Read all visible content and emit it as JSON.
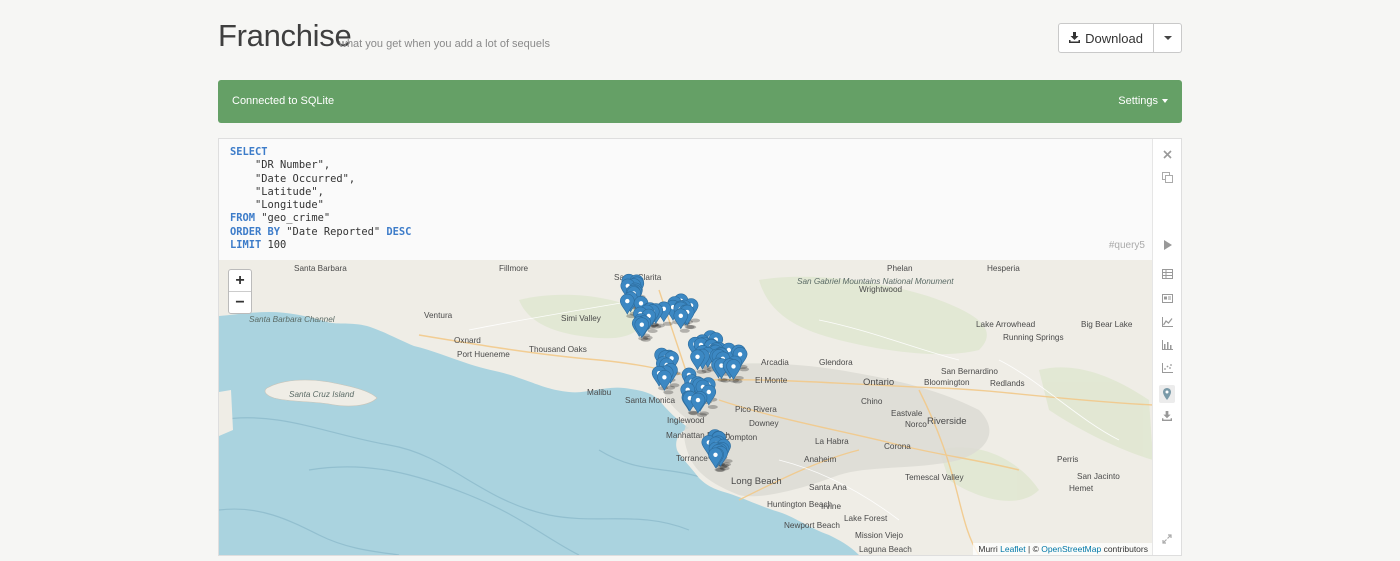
{
  "app": {
    "title": "Franchise",
    "tagline": "what you get when you add a lot of sequels"
  },
  "toolbar": {
    "download_label": "Download"
  },
  "status": {
    "connection_text": "Connected to SQLite",
    "settings_label": "Settings"
  },
  "query": {
    "code_lines": [
      [
        {
          "t": "SELECT",
          "kw": true
        }
      ],
      [
        {
          "t": "    \"DR Number\","
        }
      ],
      [
        {
          "t": "    \"Date Occurred\","
        }
      ],
      [
        {
          "t": "    \"Latitude\","
        }
      ],
      [
        {
          "t": "    \"Longitude\""
        }
      ],
      [
        {
          "t": "FROM",
          "kw": true
        },
        {
          "t": " \"geo_crime\""
        }
      ],
      [
        {
          "t": "ORDER BY",
          "kw": true
        },
        {
          "t": " \"Date Reported\" "
        },
        {
          "t": "DESC",
          "kw": true
        }
      ],
      [
        {
          "t": "LIMIT",
          "kw": true
        },
        {
          "t": " 100"
        }
      ]
    ],
    "tag": "#query5"
  },
  "side_icons": [
    "close-icon",
    "copy-icon",
    "run-icon",
    "table-view-icon",
    "card-view-icon",
    "line-chart-icon",
    "bar-chart-icon",
    "scatter-chart-icon",
    "map-view-icon",
    "download-icon",
    "expand-icon"
  ],
  "map": {
    "zoom_in": "+",
    "zoom_out": "−",
    "attribution": {
      "leaflet": "Leaflet",
      "sep": " | © ",
      "osm": "OpenStreetMap",
      "suffix": " contributors",
      "cut": "Murri"
    },
    "labels": [
      "Santa Barbara",
      "Fillmore",
      "Santa Clarita",
      "Phelan",
      "Hesperia",
      "Ventura",
      "Oxnard",
      "Simi Valley",
      "San Gabriel Mountains National Monument",
      "Wrightwood",
      "Lake Arrowhead",
      "Big Bear Lake",
      "Santa Barbara Channel",
      "Port Hueneme",
      "Thousand Oaks",
      "Arcadia",
      "Glendora",
      "Running Springs",
      "San Bernardino",
      "El Monte",
      "Ontario",
      "Bloomington",
      "Redlands",
      "Santa Cruz Island",
      "Malibu",
      "Santa Monica",
      "Pico Rivera",
      "Chino",
      "Eastvale",
      "Riverside",
      "Inglewood",
      "Downey",
      "La Habra",
      "Norco",
      "Manhattan Beach",
      "Compton",
      "Corona",
      "Torrance",
      "Anaheim",
      "Perris",
      "Long Beach",
      "Santa Ana",
      "Temescal Valley",
      "Hemet",
      "San Jacinto",
      "Huntington Beach",
      "Irvine",
      "Lake Forest",
      "Newport Beach",
      "Mission Viejo",
      "Laguna Beach"
    ],
    "pins_count": 100
  }
}
